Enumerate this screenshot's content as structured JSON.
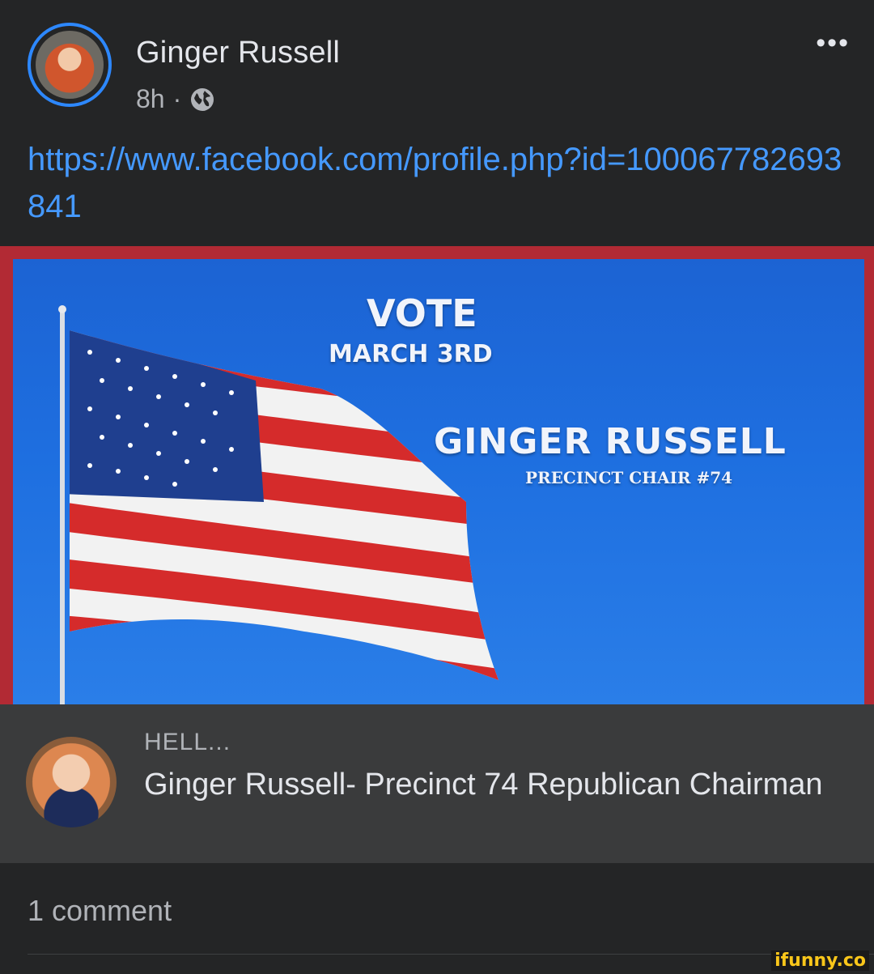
{
  "post": {
    "author": "Ginger Russell",
    "time": "8h",
    "separator": "·",
    "privacy_icon": "globe-icon",
    "more_label": "•••",
    "link_text": "https://www.facebook.com/profile.php?id=100067782693841"
  },
  "banner": {
    "headline": "VOTE",
    "date": "MARCH 3RD",
    "name": "GINGER RUSSELL",
    "role": "PRECINCT CHAIR #74"
  },
  "link_preview": {
    "domain": "HELL...",
    "title": "Ginger Russell- Precinct 74 Republican Chairman"
  },
  "footer": {
    "comments": "1 comment",
    "watermark": "ifunny.co"
  },
  "colors": {
    "background": "#242526",
    "link": "#4599ff",
    "avatar_ring": "#2d88ff",
    "banner_border": "#b22a34",
    "preview_bg": "#3a3b3c"
  }
}
